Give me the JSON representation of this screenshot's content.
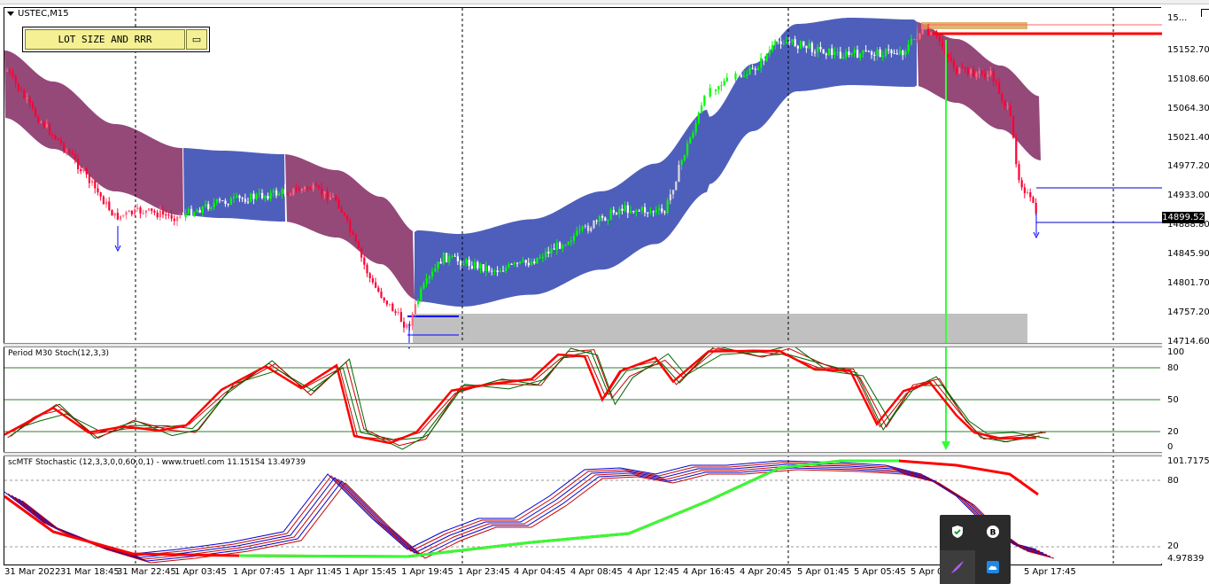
{
  "chart": {
    "symbol": "USTEC,M15",
    "lot_button_label": "LOT SIZE AND RRR",
    "lot_icon": "calculator-icon",
    "current_price": "14899.52",
    "price_axis": [
      "15...",
      "15152.70",
      "15108.60",
      "15064.30",
      "15021.40",
      "14977.20",
      "14933.00",
      "14888.80",
      "14845.90",
      "14801.70",
      "14757.20",
      "14714.60"
    ],
    "time_axis": [
      "31 Mar 2022",
      "31 Mar 18:45",
      "31 Mar 22:45",
      "1 Apr 03:45",
      "1 Apr 07:45",
      "1 Apr 11:45",
      "1 Apr 15:45",
      "1 Apr 19:45",
      "1 Apr 23:45",
      "4 Apr 04:45",
      "4 Apr 08:45",
      "4 Apr 12:45",
      "4 Apr 16:45",
      "4 Apr 20:45",
      "5 Apr 01:45",
      "5 Apr 05:45",
      "5 Apr 09:45",
      "5 Apr 17:45"
    ]
  },
  "stoch_pane": {
    "label": "Period M30 Stoch(12,3,3)",
    "levels": [
      "100",
      "80",
      "50",
      "20",
      "0"
    ]
  },
  "mtf_pane": {
    "label": "scMTF Stochastic (12,3,3,0,0,60,0,1) - www.truetl.com 11.15154 13.49739",
    "levels": [
      "101.71755",
      "80",
      "20",
      "4.97839"
    ]
  },
  "tray": {
    "icons": [
      "security-shield-icon",
      "app-b-icon",
      "feather-pen-icon",
      "cloud-icon"
    ]
  },
  "colors": {
    "bull": "#00ff00",
    "bear": "#ff0033",
    "band_blue": "#3f51b5",
    "band_purple": "#8b3a6e",
    "resistance": "#ff0000",
    "support_zone": "#c0c0c0",
    "arrow": "#33ff33"
  }
}
